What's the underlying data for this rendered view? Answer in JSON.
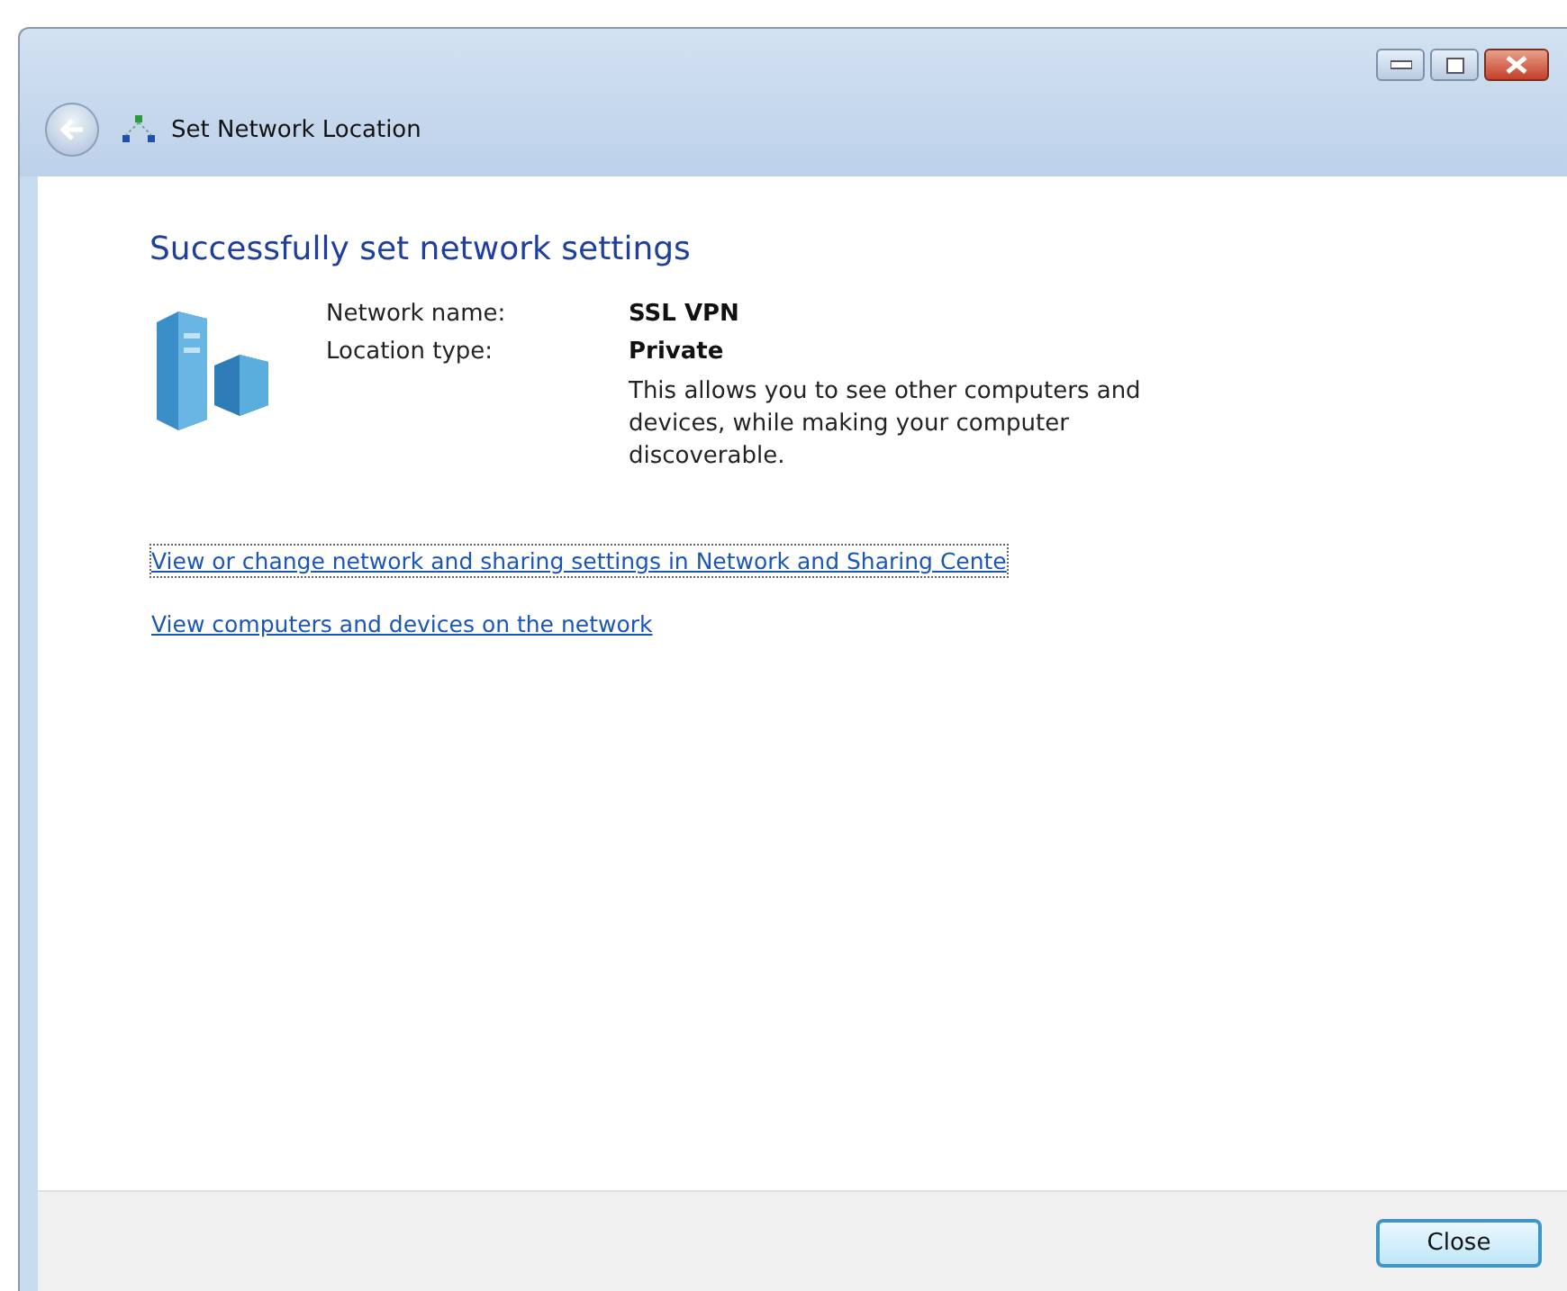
{
  "window": {
    "title": "Set Network Location"
  },
  "heading": "Successfully set network settings",
  "details": [
    {
      "label": "Network name:",
      "value": "SSL VPN"
    },
    {
      "label": "Location type:",
      "value": "Private"
    }
  ],
  "description": "This allows you to see other computers and devices, while making your computer discoverable.",
  "links": [
    {
      "text": "View or change network and sharing settings in Network and Sharing Cente",
      "focused": true
    },
    {
      "text": "View computers and devices on the network",
      "focused": false
    }
  ],
  "buttons": [
    {
      "label": "Close"
    }
  ]
}
